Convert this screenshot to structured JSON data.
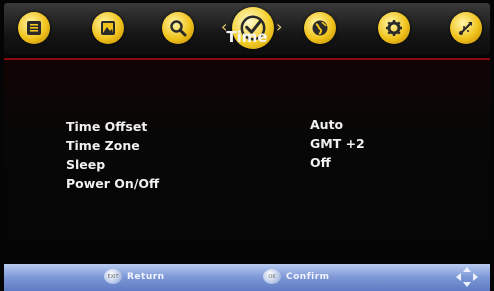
{
  "menu": {
    "icons": [
      {
        "name": "picture-mode-icon"
      },
      {
        "name": "image-icon"
      },
      {
        "name": "search-icon"
      },
      {
        "name": "clock-icon",
        "selected": true
      },
      {
        "name": "globe-icon"
      },
      {
        "name": "gear-icon"
      },
      {
        "name": "usb-icon"
      }
    ],
    "chevron_left": "‹",
    "chevron_right": "›"
  },
  "page": {
    "title": "Time"
  },
  "settings": [
    {
      "label": "Time Offset",
      "value": "Auto"
    },
    {
      "label": "Time Zone",
      "value": "GMT +2"
    },
    {
      "label": "Sleep",
      "value": "Off"
    },
    {
      "label": "Power On/Off",
      "value": ""
    }
  ],
  "footer": {
    "return_label": "Return",
    "return_button": "EXIT",
    "confirm_label": "Confirm",
    "confirm_button": "OK"
  },
  "colors": {
    "accent_yellow": "#f0c21b",
    "separator_red": "#8a0a0a",
    "footer_blue": "#7d97d6"
  }
}
